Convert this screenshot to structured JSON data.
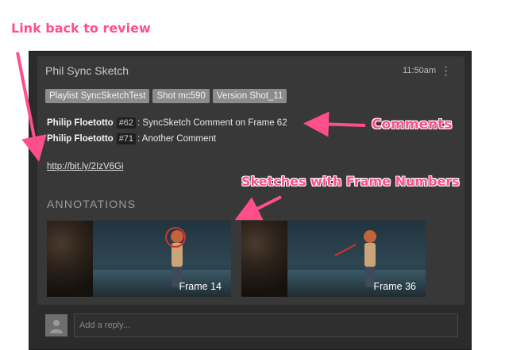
{
  "callouts": {
    "link_back": "Link back to review",
    "comments": "Comments",
    "sketches": "Sketches with Frame Numbers"
  },
  "message": {
    "sender": "Phil Sync Sketch",
    "time": "11:50am",
    "menu_icon": "kebab-menu-icon",
    "tags": [
      "Playlist SyncSketchTest",
      "Shot mc590",
      "Version Shot_11"
    ],
    "comments": [
      {
        "author": "Philip Floetotto",
        "number": "#62",
        "text": ": SyncSketch Comment on Frame 62"
      },
      {
        "author": "Philip Floetotto",
        "number": "#71",
        "text": ": Another Comment"
      }
    ],
    "link": "http://bit.ly/2IzV6Gi",
    "annotations_title": "ANNOTATIONS",
    "annotations": [
      {
        "label": "Frame 14"
      },
      {
        "label": "Frame 36"
      }
    ]
  },
  "reply": {
    "placeholder": "Add a reply..."
  },
  "colors": {
    "callout": "#ff4f8b",
    "card_bg": "#2b2b2b",
    "message_bg": "#383838",
    "tag_bg": "#8c8c8c",
    "sketch_red": "#d2322d"
  }
}
